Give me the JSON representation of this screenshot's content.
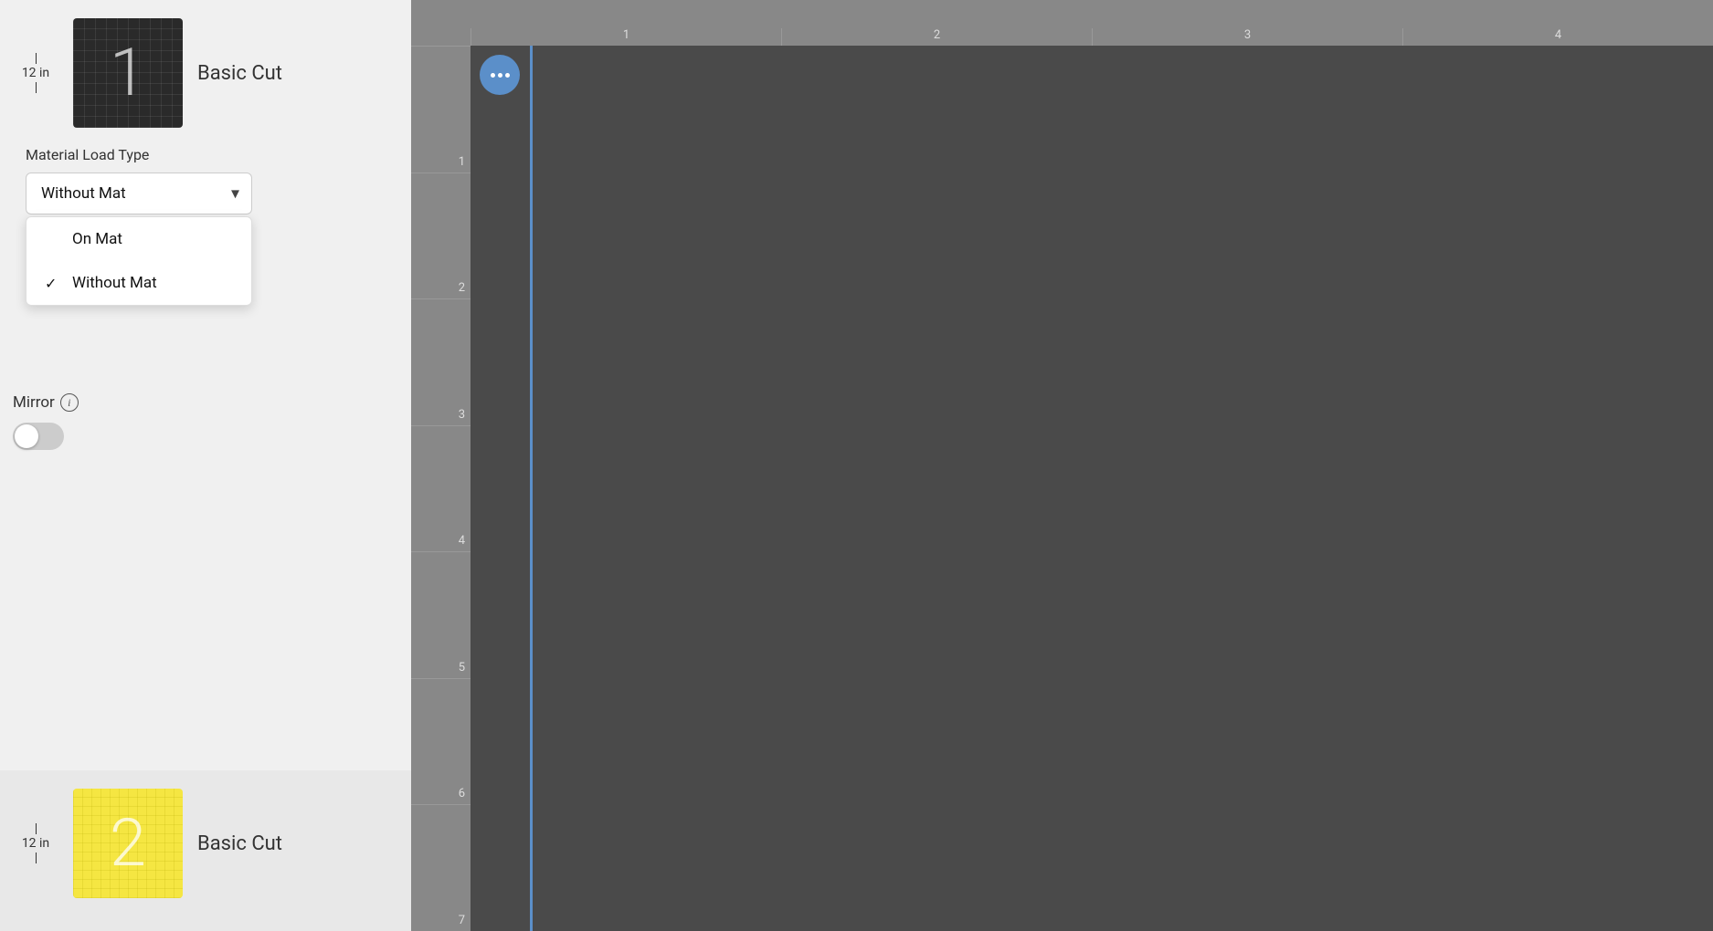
{
  "leftPanel": {
    "mat1": {
      "size": "12 in",
      "number": "1",
      "label": "Basic Cut",
      "thumbnailType": "dark"
    },
    "materialLoadType": {
      "sectionLabel": "Material Load Type",
      "selectedValue": "Without Mat",
      "options": [
        {
          "value": "On Mat",
          "selected": false
        },
        {
          "value": "Without Mat",
          "selected": true
        }
      ]
    },
    "mirror": {
      "label": "Mirror",
      "enabled": false
    },
    "mat2": {
      "size": "12 in",
      "number": "2",
      "label": "Basic Cut",
      "thumbnailType": "yellow"
    }
  },
  "canvas": {
    "rulerMarks": [
      "1",
      "2",
      "3",
      "4"
    ],
    "rulerLeftMarks": [
      "1",
      "2",
      "3",
      "4",
      "5",
      "6",
      "7"
    ],
    "moreButton": "...",
    "colors": {
      "accent": "#5b8fc9",
      "ruler": "#888888",
      "canvas": "#3d3d3d"
    }
  }
}
